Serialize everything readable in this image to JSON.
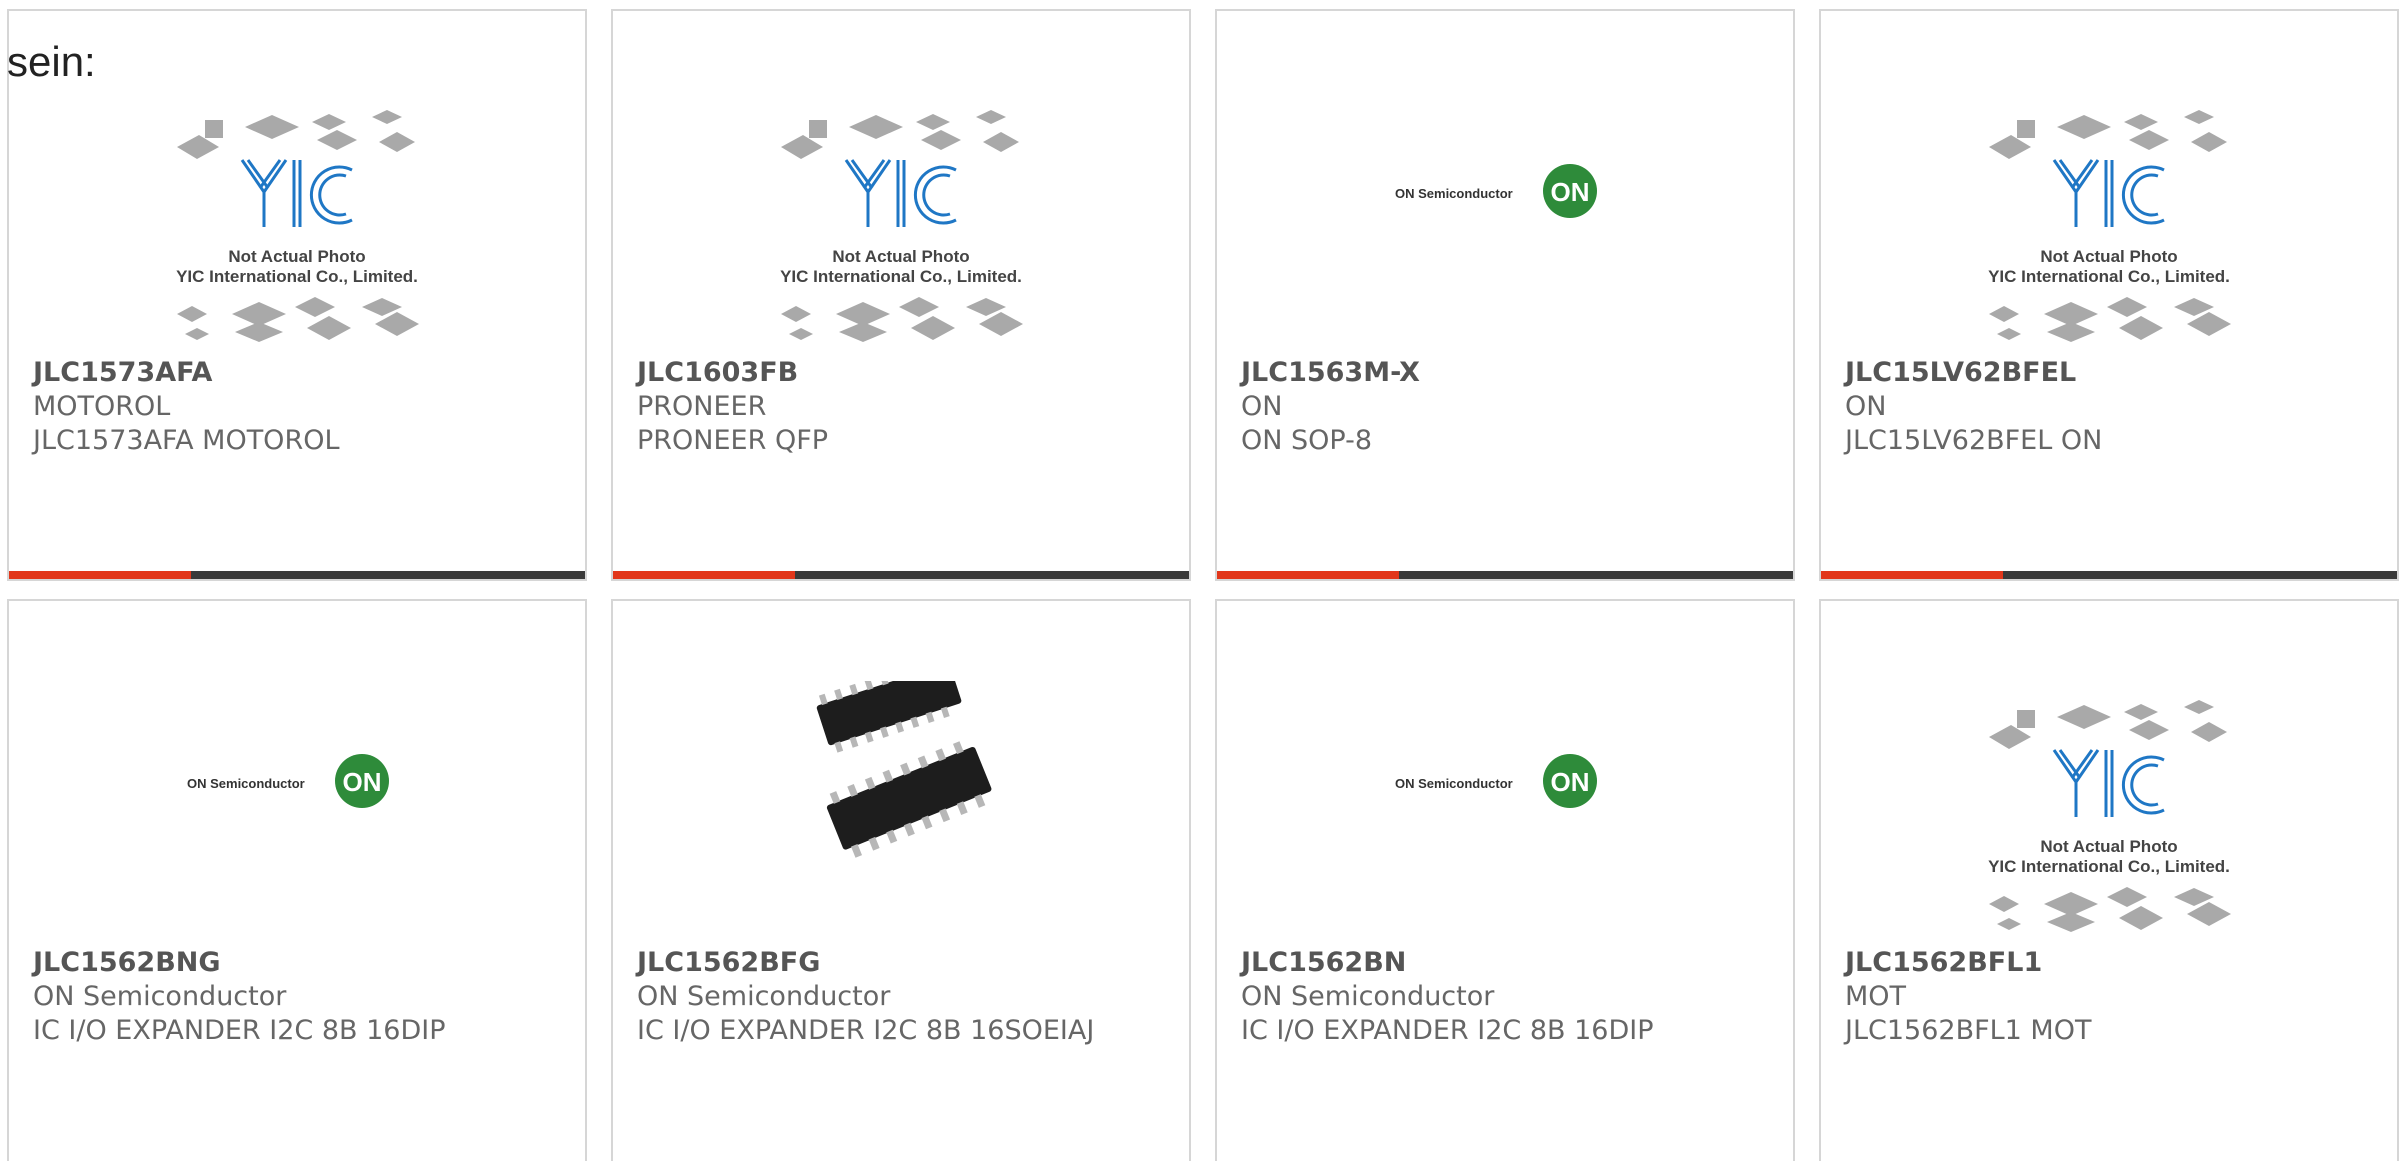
{
  "page": {
    "fragment_text": "sein:"
  },
  "colors": {
    "accent": "#e2371b",
    "bar_dark": "#3a3a3a",
    "yic_blue": "#1f77c5",
    "on_green": "#2e8b3a",
    "text_gray": "#666666"
  },
  "products": [
    {
      "part": "JLC1573AFA",
      "manufacturer": "MOTOROL",
      "description": "JLC1573AFA MOTOROL",
      "image": "yic-placeholder-icon",
      "img_line1": "Not Actual Photo",
      "img_line2": "YIC International Co., Limited."
    },
    {
      "part": "JLC1603FB",
      "manufacturer": "PRONEER",
      "description": "PRONEER QFP",
      "image": "yic-placeholder-icon",
      "img_line1": "Not Actual Photo",
      "img_line2": "YIC International Co., Limited."
    },
    {
      "part": "JLC1563M-X",
      "manufacturer": "ON",
      "description": "ON SOP-8",
      "image": "on-semiconductor-logo",
      "img_line1": "ON Semiconductor",
      "img_line2": "ON"
    },
    {
      "part": "JLC15LV62BFEL",
      "manufacturer": "ON",
      "description": "JLC15LV62BFEL ON",
      "image": "yic-placeholder-icon",
      "img_line1": "Not Actual Photo",
      "img_line2": "YIC International Co., Limited."
    },
    {
      "part": "JLC1562BNG",
      "manufacturer": "ON Semiconductor",
      "description": "IC I/O EXPANDER I2C 8B 16DIP",
      "image": "on-semiconductor-logo",
      "img_line1": "ON Semiconductor",
      "img_line2": "ON"
    },
    {
      "part": "JLC1562BFG",
      "manufacturer": "ON Semiconductor",
      "description": "IC I/O EXPANDER I2C 8B 16SOEIAJ",
      "image": "soic-chip-photo",
      "img_line1": "",
      "img_line2": ""
    },
    {
      "part": "JLC1562BN",
      "manufacturer": "ON Semiconductor",
      "description": "IC I/O EXPANDER I2C 8B 16DIP",
      "image": "on-semiconductor-logo",
      "img_line1": "ON Semiconductor",
      "img_line2": "ON"
    },
    {
      "part": "JLC1562BFL1",
      "manufacturer": "MOT",
      "description": "JLC1562BFL1 MOT",
      "image": "yic-placeholder-icon",
      "img_line1": "Not Actual Photo",
      "img_line2": "YIC International Co., Limited."
    }
  ]
}
